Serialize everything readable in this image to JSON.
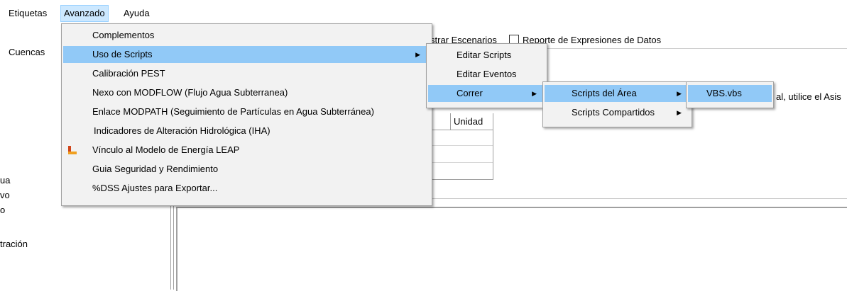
{
  "menubar": {
    "items": [
      "Etiquetas",
      "Avanzado",
      "Ayuda"
    ]
  },
  "leftpane": {
    "items": [
      "Cuencas",
      "ua",
      "vo",
      "o",
      "tración"
    ]
  },
  "toolbar": {
    "scenarios_label": "strar Escenarios",
    "report_label": "Reporte de Expresiones de Datos",
    "hint_text": "al, utilice el Asis"
  },
  "table": {
    "header_unit": "Unidad"
  },
  "menu_avanzado": {
    "items": [
      "Complementos",
      "Uso de Scripts",
      "Calibración PEST",
      "Nexo con MODFLOW (Flujo Agua Subterranea)",
      "Enlace MODPATH (Seguimiento de Partículas en Agua Subterránea)",
      "Indicadores de Alteración Hidrológica (IHA)",
      "Vínculo al Modelo de Energía LEAP",
      "Guia Seguridad y Rendimiento",
      "%DSS Ajustes para Exportar..."
    ]
  },
  "menu_scripts": {
    "items": [
      "Editar Scripts",
      "Editar Eventos",
      "Correr"
    ]
  },
  "menu_correr": {
    "items": [
      "Scripts del Área",
      "Scripts Compartidos"
    ]
  },
  "menu_area": {
    "items": [
      "VBS.vbs"
    ]
  },
  "colors": {
    "highlight": "#91c9f7",
    "menu_bg": "#f2f2f2",
    "active_menubar": "#cce8ff"
  }
}
